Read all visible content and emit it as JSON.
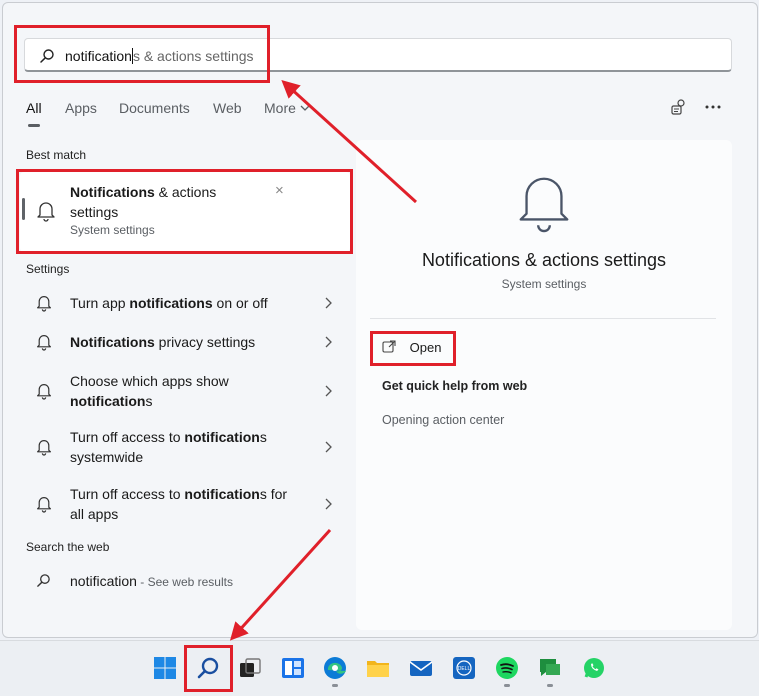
{
  "search": {
    "typed": "notification",
    "typed_tail": "s",
    "ghost": " & actions settings"
  },
  "tabs": [
    "All",
    "Apps",
    "Documents",
    "Web",
    "More"
  ],
  "active_tab": "All",
  "sections": {
    "best_match": "Best match",
    "settings": "Settings",
    "search_web": "Search the web"
  },
  "best_match": {
    "title_bold": "Notifications",
    "title_rest_1": " & actions",
    "title_rest_2": "settings",
    "subtitle": "System settings",
    "close_glyph": "×"
  },
  "settings_items": [
    {
      "pre": "Turn app ",
      "bold": "notifications",
      "post": " on or off",
      "line2": ""
    },
    {
      "pre": "",
      "bold": "Notifications",
      "post": " privacy settings",
      "line2": ""
    },
    {
      "pre": "Choose which apps show",
      "bold": "",
      "post": "",
      "line2_bold": "notification",
      "line2": "s"
    },
    {
      "pre": "Turn off access to ",
      "bold": "notification",
      "post": "s",
      "line2": "systemwide"
    },
    {
      "pre": "Turn off access to ",
      "bold": "notification",
      "post": "s for",
      "line2": "all apps"
    }
  ],
  "web_item": {
    "query": "notification",
    "suffix": " - See web results"
  },
  "right_panel": {
    "title": "Notifications & actions settings",
    "subtitle": "System settings",
    "open_label": "Open",
    "quick_help": "Get quick help from web",
    "opening": "Opening action center"
  },
  "colors": {
    "annotation_red": "#e0202a",
    "background": "#f4f6f9"
  },
  "taskbar_icons": [
    "windows-start-icon",
    "search-icon",
    "task-view-icon",
    "widgets-icon",
    "edge-icon",
    "file-explorer-icon",
    "mail-icon",
    "dell-icon",
    "spotify-icon",
    "google-chat-icon",
    "whatsapp-icon"
  ]
}
